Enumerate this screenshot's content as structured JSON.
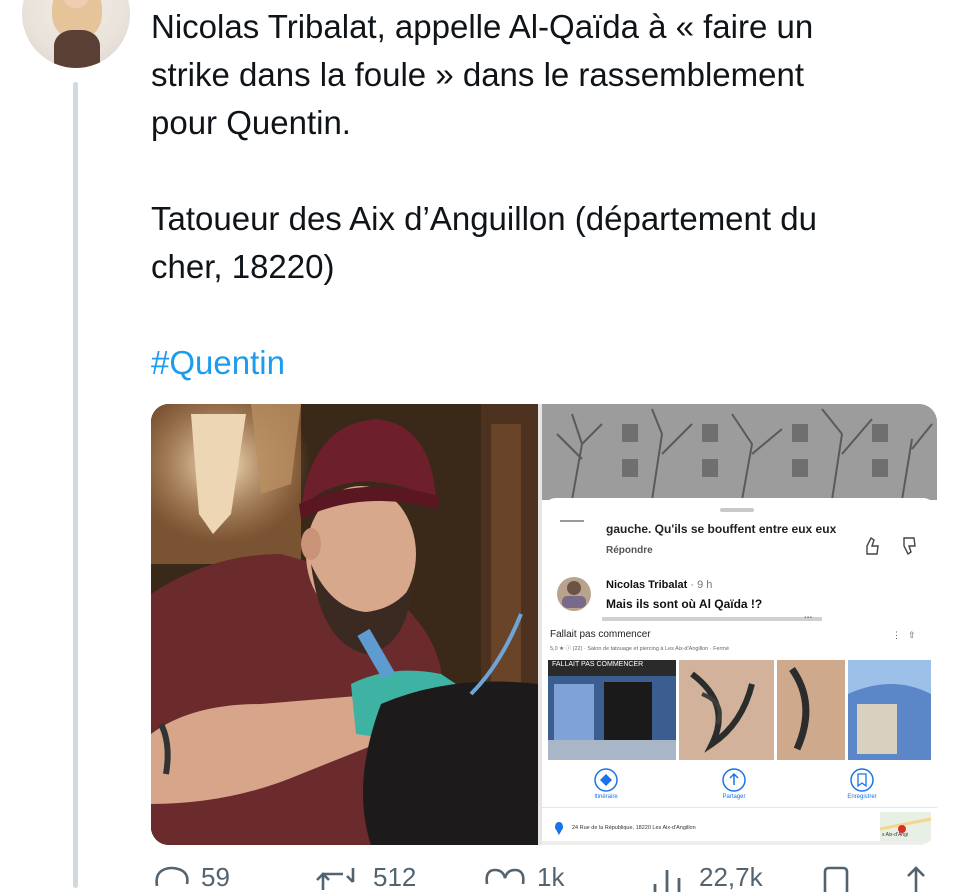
{
  "tweet": {
    "line1": "Nicolas Tribalat, appelle Al-Qaïda à « faire un",
    "line2": "strike dans la foule » dans le rassemblement",
    "line3": "pour Quentin.",
    "line4": "Tatoueur des Aix d’Anguillon (département du",
    "line5": "cher, 18220)",
    "hashtag": "#Quentin"
  },
  "screenshot": {
    "comment_prev": "gauche. Qu'ils se bouffent entre eux eux",
    "reply_label": "Répondre",
    "commenter_name": "Nicolas Tribalat",
    "comment_time": "· 9 h",
    "comment_text": "Mais ils sont où  Al Qaïda !?",
    "comment_overflow": "...",
    "business_name": "Fallait pas commencer",
    "business_meta": "5,0 ★ ⓘ (22) · Salon de tatouage et piercing à Les Aix-d'Angillon · Fermé",
    "storefront_sign": "FALLAIT PAS COMMENCER",
    "actions": [
      "Itinéraire",
      "Partager",
      "Enregistrer"
    ],
    "address": "24 Rue de la République, 18220 Les Aix-d'Angillon",
    "map_label": "s Aix-d'Angi"
  },
  "stats": {
    "replies": "59",
    "reposts": "512",
    "likes": "1k",
    "views": "22,7k"
  },
  "colors": {
    "accent": "#1d9bf0",
    "muted": "#536471",
    "thread": "#cfd9de"
  }
}
